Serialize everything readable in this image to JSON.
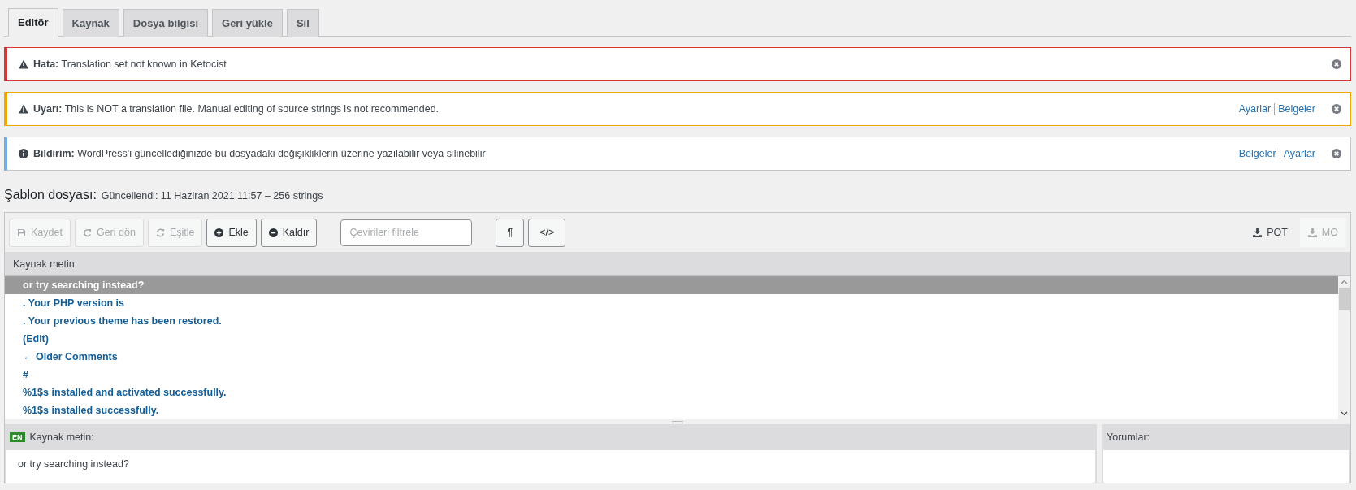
{
  "tabs": [
    {
      "label": "Editör",
      "selected": true
    },
    {
      "label": "Kaynak",
      "selected": false
    },
    {
      "label": "Dosya bilgisi",
      "selected": false
    },
    {
      "label": "Geri yükle",
      "selected": false
    },
    {
      "label": "Sil",
      "selected": false
    }
  ],
  "notices": [
    {
      "kind": "error",
      "label": "Hata:",
      "text": "Translation set not known in Ketocist"
    },
    {
      "kind": "warning",
      "label": "Uyarı:",
      "text": "This is NOT a translation file. Manual editing of source strings is not recommended.",
      "links": [
        "Ayarlar",
        "Belgeler"
      ]
    },
    {
      "kind": "info",
      "label": "Bildirim:",
      "text": "WordPress'i güncellediğinizde bu dosyadaki değişikliklerin üzerine yazılabilir veya silinebilir",
      "links": [
        "Belgeler",
        "Ayarlar"
      ]
    }
  ],
  "heading": {
    "title": "Şablon dosyası:",
    "meta": "Güncellendi: 11 Haziran 2021 11:57 – 256 strings"
  },
  "toolbar": {
    "buttons": [
      {
        "kind": "save",
        "label": "Kaydet",
        "disabled": true
      },
      {
        "kind": "revert",
        "label": "Geri dön",
        "disabled": true
      },
      {
        "kind": "sync",
        "label": "Eşitle",
        "disabled": true
      },
      {
        "kind": "add",
        "label": "Ekle",
        "disabled": false
      },
      {
        "kind": "remove",
        "label": "Kaldır",
        "disabled": false
      }
    ],
    "filter_placeholder": "Çevirileri filtrele",
    "toggles": [
      "¶",
      "</>"
    ],
    "downloads": [
      {
        "label": "POT",
        "disabled": false
      },
      {
        "label": "MO",
        "disabled": true
      }
    ]
  },
  "list": {
    "header": "Kaynak metin",
    "rows": [
      {
        "text": "or try searching instead?",
        "selected": true
      },
      {
        "text": ". Your PHP version is",
        "selected": false
      },
      {
        "text": ". Your previous theme has been restored.",
        "selected": false
      },
      {
        "text": "(Edit)",
        "selected": false
      },
      {
        "text": "← Older Comments",
        "selected": false
      },
      {
        "text": "#",
        "selected": false
      },
      {
        "text": "%1$s installed and activated successfully.",
        "selected": false
      },
      {
        "text": "%1$s installed successfully.",
        "selected": false
      }
    ]
  },
  "source_panel": {
    "lang": "EN",
    "title": "Kaynak metin:",
    "value": "or try searching instead?"
  },
  "comments_panel": {
    "title": "Yorumlar:"
  }
}
